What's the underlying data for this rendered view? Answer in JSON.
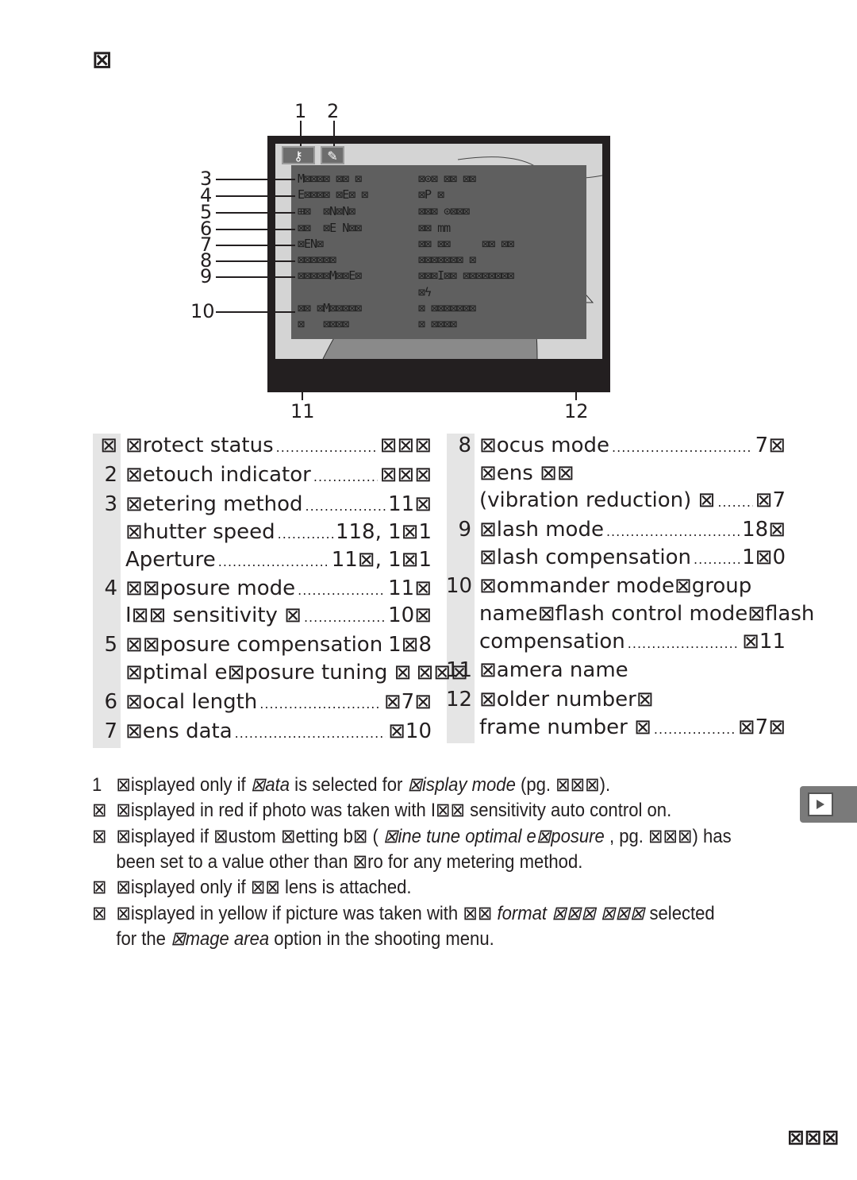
{
  "header": {
    "title": "⊠"
  },
  "figure": {
    "top_callouts": [
      "1",
      "2"
    ],
    "left_callouts": [
      "3",
      "4",
      "5",
      "6",
      "7",
      "8",
      "9",
      "10"
    ],
    "bottom_callouts": [
      "11",
      "12"
    ],
    "icons": {
      "protect": "key-icon",
      "retouch": "retouch-brush-icon"
    },
    "screen_rows": [
      [
        "M⊠⊠⊠⊠ ⊠⊠ ⊠",
        "⊠⊙⊠ ⊠⊠ ⊠⊠"
      ],
      [
        "E⊠⊠⊠⊠ ⊠E⊠ ⊠",
        "⊠P ⊠"
      ],
      [
        "⊞⊠  ⊠N⊠N⊠",
        "⊠⊠⊠ ⊙⊠⊠⊠"
      ],
      [
        "⊠⊠  ⊠E N⊠⊠",
        "⊠⊠ mm"
      ],
      [
        "⊠EN⊠",
        "⊠⊠ ⊠⊠     ⊠⊠ ⊠⊠"
      ],
      [
        "⊠⊠⊠⊠⊠⊠",
        "⊠⊠⊠⊠⊠⊠⊠ ⊠"
      ],
      [
        "⊠⊠⊠⊠⊠M⊠⊠E⊠",
        "⊠⊠⊠I⊠⊠ ⊠⊠⊠⊠⊠⊠⊠⊠"
      ],
      [
        "",
        "⊠ϟ"
      ],
      [
        "⊠⊠ ⊠M⊠⊠⊠⊠⊠",
        "⊠ ⊠⊠⊠⊠⊠⊠⊠"
      ],
      [
        "⊠   ⊠⊠⊠⊠",
        "⊠ ⊠⊠⊠⊠"
      ]
    ]
  },
  "left_list": [
    {
      "num": "⊠",
      "label": "⊠rotect status",
      "page": "⊠⊠⊠"
    },
    {
      "num": "2",
      "label": "⊠etouch indicator",
      "page": "⊠⊠⊠"
    },
    {
      "num": "3",
      "label": "⊠etering method",
      "page": "11⊠"
    },
    {
      "num": "",
      "label": "⊠hutter speed",
      "page": "118, 1⊠1"
    },
    {
      "num": "",
      "label": "Aperture",
      "page": "11⊠, 1⊠1"
    },
    {
      "num": "4",
      "label": "⊠⊠posure mode",
      "page": "11⊠"
    },
    {
      "num": "",
      "label": "I⊠⊠ sensitivity ⊠",
      "page": "10⊠"
    },
    {
      "num": "5",
      "label": "⊠⊠posure compensation",
      "page": "1⊠8"
    },
    {
      "num": "",
      "label": "⊠ptimal e⊠posure tuning ⊠",
      "page": "⊠⊠⊠"
    },
    {
      "num": "6",
      "label": "⊠ocal length",
      "page": "⊠7⊠"
    },
    {
      "num": "7",
      "label": "⊠ens data",
      "page": "⊠10"
    }
  ],
  "right_list": [
    {
      "num": "8",
      "label": "⊠ocus mode",
      "page": "7⊠"
    },
    {
      "num": "",
      "label": "⊠ens ⊠⊠",
      "page": ""
    },
    {
      "num": "",
      "label": "(vibration reduction) ⊠",
      "page": "⊠7"
    },
    {
      "num": "9",
      "label": "⊠lash mode",
      "page": "18⊠"
    },
    {
      "num": "",
      "label": "⊠lash compensation",
      "page": "1⊠0"
    },
    {
      "num": "10",
      "label": "⊠ommander mode⊠group",
      "page": ""
    },
    {
      "num": "",
      "label": "name⊠flash control mode⊠flash",
      "page": ""
    },
    {
      "num": "",
      "label": "compensation",
      "page": "⊠11"
    },
    {
      "num": "11",
      "label": "⊠amera name",
      "page": ""
    },
    {
      "num": "12",
      "label": "⊠older number⊠",
      "page": ""
    },
    {
      "num": "",
      "label": "frame number ⊠",
      "page": "⊠7⊠"
    }
  ],
  "footnotes": [
    {
      "mark": "1",
      "parts": [
        [
          "⊠isplayed only if ",
          ""
        ],
        [
          "⊠ata",
          "i"
        ],
        [
          "  is selected for ",
          ""
        ],
        [
          "⊠isplay mode",
          "i"
        ],
        [
          "    (pg. ⊠⊠⊠).",
          ""
        ]
      ]
    },
    {
      "mark": "⊠",
      "parts": [
        [
          "⊠isplayed in red if photo was taken with I⊠⊠ sensitivity auto control on.",
          ""
        ]
      ]
    },
    {
      "mark": "⊠",
      "parts": [
        [
          "⊠isplayed if ⊠ustom ⊠etting b⊠ ( ",
          ""
        ],
        [
          "⊠ine tune optimal e⊠posure",
          "i"
        ],
        [
          "     , pg. ⊠⊠⊠) has",
          ""
        ]
      ]
    },
    {
      "mark": "",
      "parts": [
        [
          "been set to a value other than ⊠ro for any metering method.",
          ""
        ]
      ]
    },
    {
      "mark": "⊠",
      "parts": [
        [
          "⊠isplayed only if ⊠⊠ lens is attached.",
          ""
        ]
      ]
    },
    {
      "mark": "⊠",
      "parts": [
        [
          "⊠isplayed in yellow if picture was taken with  ⊠⊠ ",
          ""
        ],
        [
          "format ⊠⊠⊠ ⊠⊠⊠",
          "i"
        ],
        [
          "      selected",
          ""
        ]
      ]
    },
    {
      "mark": "",
      "parts": [
        [
          "for the ",
          ""
        ],
        [
          "⊠mage area",
          "i"
        ],
        [
          "  option in the shooting menu.",
          ""
        ]
      ]
    }
  ],
  "side_tab": {
    "icon": "playback-icon"
  },
  "page_number": "⊠⊠⊠"
}
